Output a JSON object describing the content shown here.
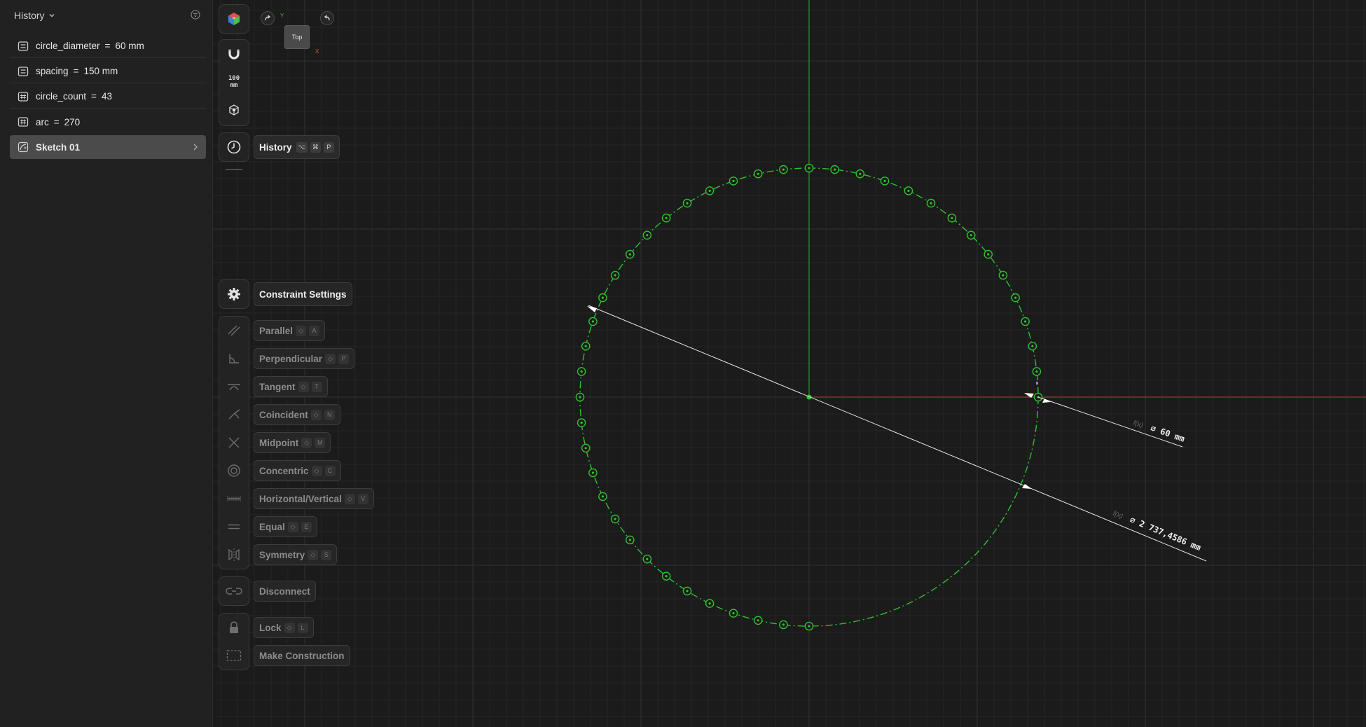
{
  "history": {
    "title": "History",
    "items": [
      {
        "name": "circle_diameter",
        "eq": "=",
        "value": "60 mm",
        "type": "length"
      },
      {
        "name": "spacing",
        "eq": "=",
        "value": "150 mm",
        "type": "length"
      },
      {
        "name": "circle_count",
        "eq": "=",
        "value": "43",
        "type": "number"
      },
      {
        "name": "arc",
        "eq": "=",
        "value": "270",
        "type": "number"
      }
    ],
    "sketch": "Sketch 01"
  },
  "toolbar": {
    "grid_size": "100\nmm",
    "history_label": "History",
    "history_keys": [
      "⌥",
      "⌘",
      "P"
    ]
  },
  "viewcube": {
    "face": "Top",
    "y": "Y",
    "x": "X"
  },
  "constraints": {
    "settings": "Constraint Settings",
    "items": [
      {
        "label": "Parallel",
        "mod": "◇",
        "key": "A"
      },
      {
        "label": "Perpendicular",
        "mod": "◇",
        "key": "P"
      },
      {
        "label": "Tangent",
        "mod": "◇",
        "key": "T"
      },
      {
        "label": "Coincident",
        "mod": "◇",
        "key": "N"
      },
      {
        "label": "Midpoint",
        "mod": "◇",
        "key": "M"
      },
      {
        "label": "Concentric",
        "mod": "◇",
        "key": "C"
      },
      {
        "label": "Horizontal/Vertical",
        "mod": "◇",
        "key": "V"
      },
      {
        "label": "Equal",
        "mod": "◇",
        "key": "E"
      },
      {
        "label": "Symmetry",
        "mod": "◇",
        "key": "S"
      }
    ],
    "disconnect": "Disconnect",
    "lock": {
      "label": "Lock",
      "mod": "◇",
      "key": "L"
    },
    "construction": "Make Construction"
  },
  "dimensions": {
    "small": {
      "fx": "f(x)",
      "text": "⌀ 60 mm"
    },
    "large": {
      "fx": "f(x)",
      "text": "⌀ 2 737,4586 mm"
    }
  },
  "colors": {
    "sketch": "#2fc12f",
    "grid_minor": "#262626",
    "grid_major": "#313131",
    "x_axis": "#7a3b30",
    "y_axis": "#2f7a2f"
  }
}
